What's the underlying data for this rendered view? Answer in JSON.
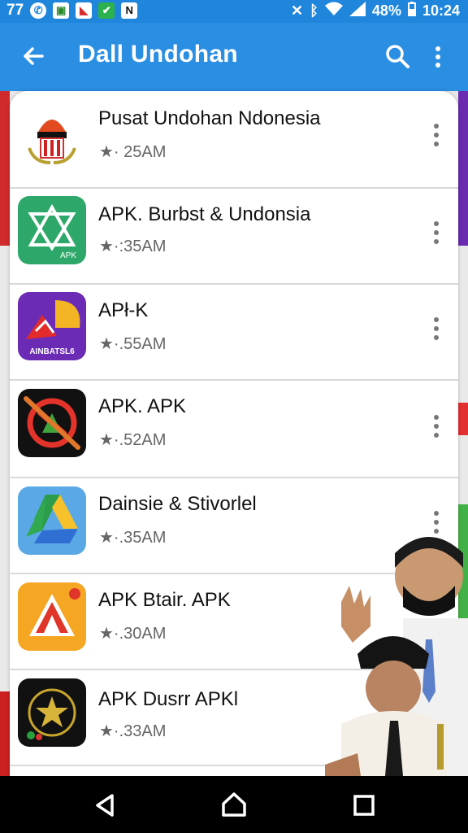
{
  "status_bar": {
    "notification_count": "77",
    "right_battery": "48%",
    "time": "10:24",
    "icon_colors": {
      "bg": "#1f86dc"
    }
  },
  "app_bar": {
    "title": "Dall Undohan",
    "back_icon": "back-arrow-icon",
    "search_icon": "search-icon",
    "overflow_icon": "more-vert-icon",
    "color": "#2a8ee3"
  },
  "apps": [
    {
      "title": "Pusat Undohan Ndonesia",
      "subtitle": "★· 25AM",
      "icon": "emblem-icon"
    },
    {
      "title": "APK. Burbst & Undonsia",
      "subtitle": "★·:35AM",
      "icon": "apk-triangle-icon",
      "icon_label": "APK"
    },
    {
      "title": "APł-K",
      "subtitle": "★·.55AM",
      "icon": "shell-flag-icon",
      "icon_label": "AINBATSL6"
    },
    {
      "title": "APK. APK",
      "subtitle": "★·.52AM",
      "icon": "no-sign-icon"
    },
    {
      "title": "Dainsie & Stivorlel",
      "subtitle": "★·.35AM",
      "icon": "drive-icon"
    },
    {
      "title": "APK Btair. APK",
      "subtitle": "★·.30AM",
      "icon": "triangle-logo-icon"
    },
    {
      "title": "APK Dusrr APKl",
      "subtitle": "★·.33AM",
      "icon": "star-crest-icon"
    }
  ],
  "nav_bar": {
    "back_icon": "nav-back-icon",
    "home_icon": "nav-home-icon",
    "recents_icon": "nav-recents-icon"
  }
}
